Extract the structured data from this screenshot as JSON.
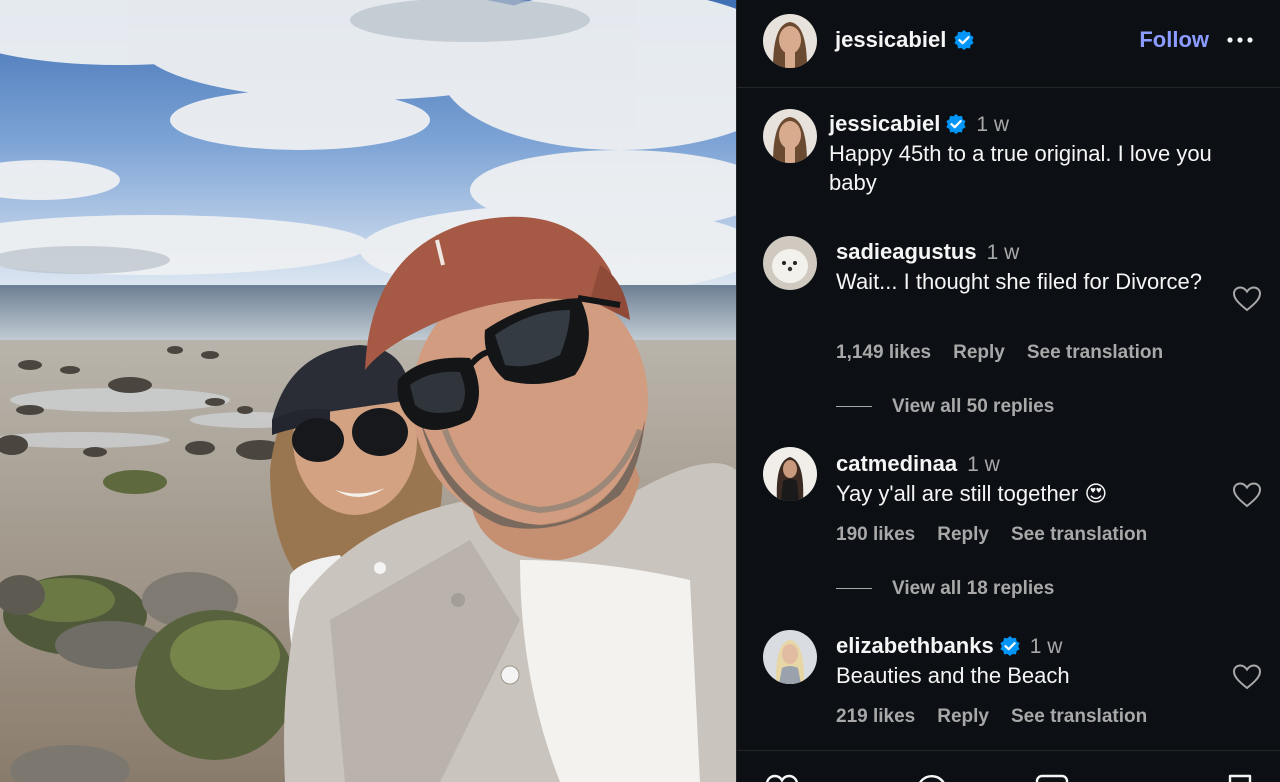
{
  "post": {
    "author": "jessicabiel",
    "follow_label": "Follow",
    "caption": {
      "username": "jessicabiel",
      "time": "1 w",
      "text": "Happy 45th to a true original. I love you baby"
    }
  },
  "comments": [
    {
      "username": "sadieagustus",
      "time": "1 w",
      "text": "Wait... I thought she filed for Divorce?",
      "likes": "1,149 likes",
      "reply_label": "Reply",
      "translate_label": "See translation",
      "view_replies": "View all 50 replies"
    },
    {
      "username": "catmedinaa",
      "time": "1 w",
      "text": "Yay y'all are still together 😍",
      "likes": "190 likes",
      "reply_label": "Reply",
      "translate_label": "See translation",
      "view_replies": "View all 18 replies"
    },
    {
      "username": "elizabethbanks",
      "time": "1 w",
      "text": "Beauties and the Beach",
      "likes": "219 likes",
      "reply_label": "Reply",
      "translate_label": "See translation"
    }
  ],
  "icons": {
    "verified": "verified-badge-icon",
    "more": "more-options-icon",
    "like": "heart-icon",
    "comment": "comment-icon",
    "share": "share-icon",
    "save": "bookmark-icon"
  },
  "colors": {
    "background": "#0c1014",
    "follow": "#8b9bff",
    "verified": "#0095f6",
    "muted": "#a8a8a8"
  }
}
